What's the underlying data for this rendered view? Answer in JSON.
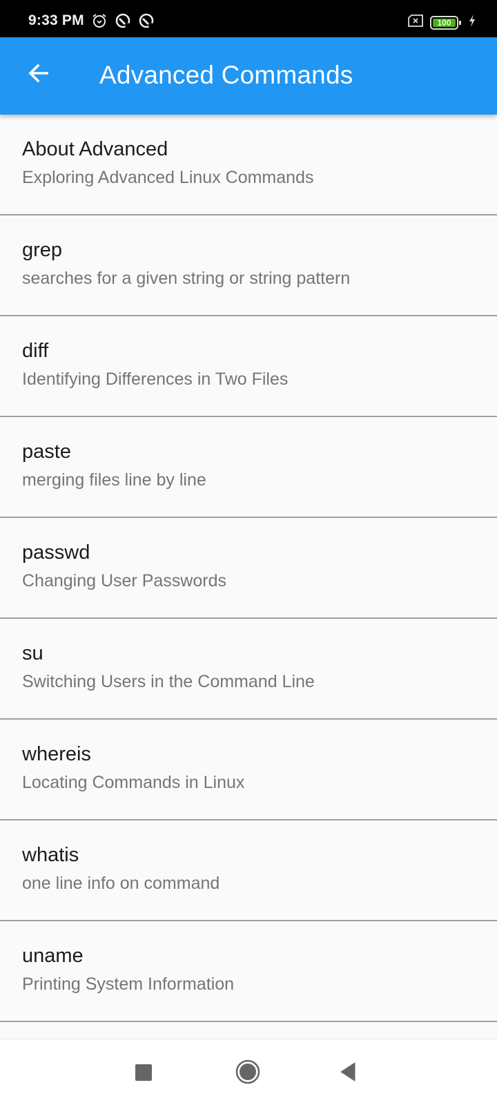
{
  "status_bar": {
    "time": "9:33 PM",
    "left_icons": [
      "alarm-icon",
      "data-saver-icon",
      "data-saver-icon"
    ],
    "battery_level": "100",
    "right_icons": [
      "no-sim-icon",
      "battery-icon",
      "charging-icon"
    ]
  },
  "app_bar": {
    "back_icon": "arrow-back-icon",
    "title": "Advanced Commands",
    "color": "#2196f3"
  },
  "list": {
    "items": [
      {
        "title": "About Advanced",
        "subtitle": "Exploring Advanced Linux Commands"
      },
      {
        "title": "grep",
        "subtitle": "searches for a given string or string pattern"
      },
      {
        "title": "diff",
        "subtitle": "Identifying Differences in Two Files"
      },
      {
        "title": "paste",
        "subtitle": "merging files line by line"
      },
      {
        "title": "passwd",
        "subtitle": "Changing User Passwords"
      },
      {
        "title": "su",
        "subtitle": "Switching Users in the Command Line"
      },
      {
        "title": "whereis",
        "subtitle": "Locating Commands in Linux"
      },
      {
        "title": "whatis",
        "subtitle": "one line info on command"
      },
      {
        "title": "uname",
        "subtitle": "Printing System Information"
      }
    ]
  },
  "nav_bar": {
    "buttons": [
      "recents-icon",
      "home-icon",
      "back-icon"
    ]
  }
}
